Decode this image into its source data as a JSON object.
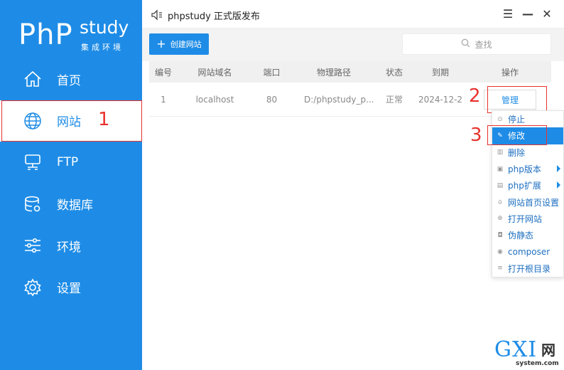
{
  "sidebar": {
    "logo_php": "PhP",
    "logo_study": "study",
    "logo_sub": "集成环境",
    "items": [
      {
        "label": "首页",
        "icon": "home-icon"
      },
      {
        "label": "网站",
        "icon": "globe-icon"
      },
      {
        "label": "FTP",
        "icon": "ftp-icon"
      },
      {
        "label": "数据库",
        "icon": "database-icon"
      },
      {
        "label": "环境",
        "icon": "sliders-icon"
      },
      {
        "label": "设置",
        "icon": "gear-icon"
      }
    ]
  },
  "window": {
    "title": "phpstudy 正式版发布",
    "menu_glyph": "☰",
    "min_glyph": "—",
    "close_glyph": "✕"
  },
  "toolbar": {
    "create_label": "创建网站",
    "create_glyph": "+",
    "search_placeholder": "查找"
  },
  "table": {
    "headers": [
      "编号",
      "网站域名",
      "端口",
      "物理路径",
      "状态",
      "到期",
      "操作"
    ],
    "rows": [
      {
        "id": "1",
        "domain": "localhost",
        "port": "80",
        "path": "D:/phpstudy_p...",
        "status": "正常",
        "expire": "2024-12-2",
        "action": "管理"
      }
    ]
  },
  "context_menu": {
    "items": [
      {
        "label": "停止",
        "icon": "stop-icon",
        "submenu": false
      },
      {
        "label": "修改",
        "icon": "edit-icon",
        "submenu": false
      },
      {
        "label": "删除",
        "icon": "trash-icon",
        "submenu": false
      },
      {
        "label": "php版本",
        "icon": "php-version-icon",
        "submenu": true
      },
      {
        "label": "php扩展",
        "icon": "php-extension-icon",
        "submenu": true
      },
      {
        "label": "网站首页设置",
        "icon": "homepage-icon",
        "submenu": false
      },
      {
        "label": "打开网站",
        "icon": "open-site-icon",
        "submenu": false
      },
      {
        "label": "伪静态",
        "icon": "rewrite-icon",
        "submenu": false
      },
      {
        "label": "composer",
        "icon": "composer-icon",
        "submenu": false
      },
      {
        "label": "打开根目录",
        "icon": "folder-icon",
        "submenu": false
      }
    ]
  },
  "annotations": {
    "step1": "1",
    "step2": "2",
    "step3": "3"
  },
  "watermark": {
    "brand": "GXI",
    "cn": "网",
    "url": "system.com"
  },
  "colors": {
    "brand_blue": "#1e8ce6",
    "annotation_red": "#e8322e"
  }
}
